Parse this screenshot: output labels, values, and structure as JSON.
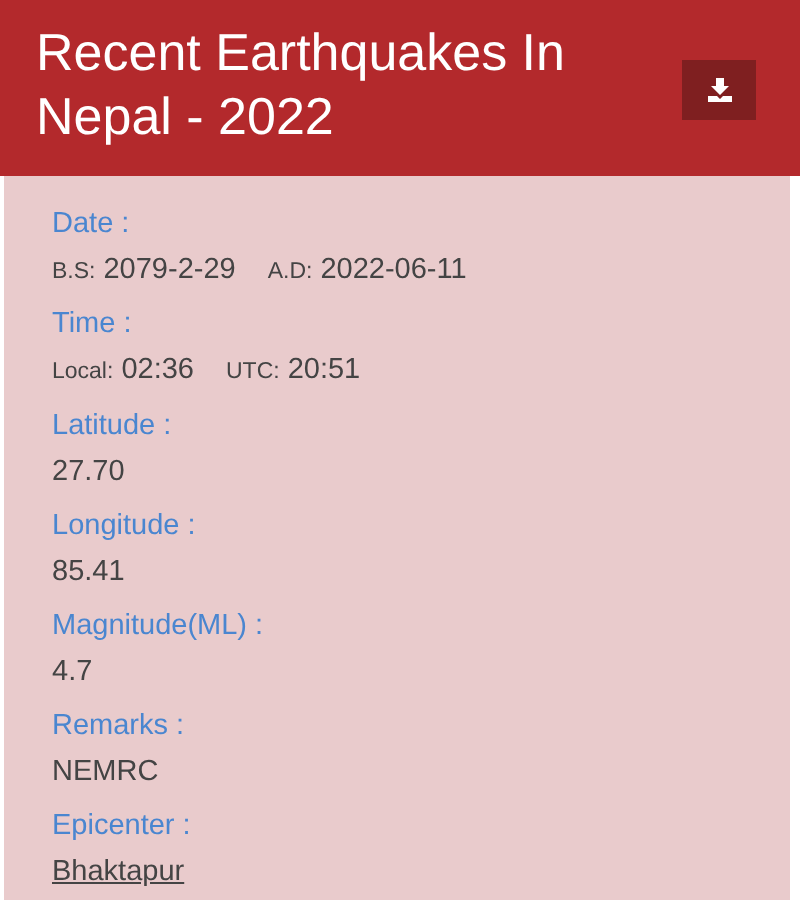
{
  "header": {
    "title": "Recent Earthquakes In Nepal - 2022"
  },
  "fields": [
    {
      "kind": "pairs",
      "label": "Date :",
      "pairs": [
        {
          "prefix": "B.S:",
          "value": "2079-2-29"
        },
        {
          "prefix": "A.D:",
          "value": "2022-06-11"
        }
      ]
    },
    {
      "kind": "pairs",
      "label": "Time :",
      "pairs": [
        {
          "prefix": "Local:",
          "value": "02:36"
        },
        {
          "prefix": "UTC:",
          "value": "20:51"
        }
      ]
    },
    {
      "kind": "text",
      "label": "Latitude :",
      "value": "27.70"
    },
    {
      "kind": "text",
      "label": "Longitude :",
      "value": "85.41"
    },
    {
      "kind": "text",
      "label": "Magnitude(ML) :",
      "value": "4.7"
    },
    {
      "kind": "text",
      "label": "Remarks :",
      "value": "NEMRC"
    },
    {
      "kind": "link",
      "label": "Epicenter :",
      "value": "Bhaktapur"
    }
  ]
}
